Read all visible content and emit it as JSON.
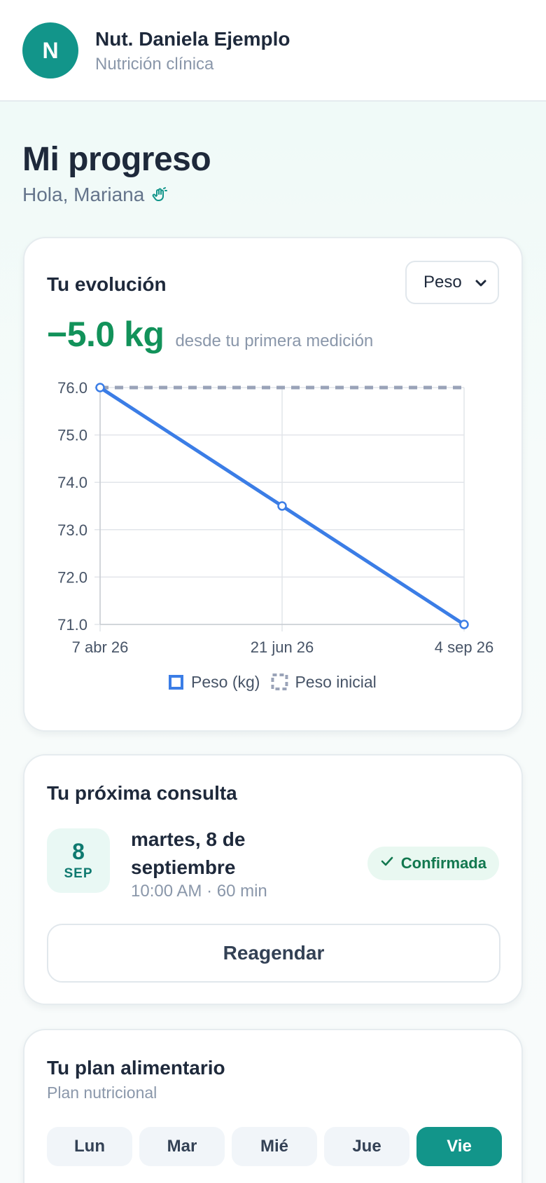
{
  "header": {
    "avatar_initial": "N",
    "nutritionist_name": "Nut. Daniela Ejemplo",
    "specialty": "Nutrición clínica"
  },
  "page": {
    "title": "Mi progreso",
    "greeting": "Hola, Mariana",
    "greeting_icon": "waving-hand-icon"
  },
  "evolution": {
    "title": "Tu evolución",
    "metric_select": {
      "selected": "Peso"
    },
    "delta_value": "−5.0 kg",
    "delta_caption": "desde tu primera medición"
  },
  "chart_data": {
    "type": "line",
    "x": [
      "7 abr 26",
      "21 jun 26",
      "4 sep 26"
    ],
    "series": [
      {
        "name": "Peso (kg)",
        "values": [
          76.0,
          73.5,
          71.0
        ],
        "color": "#3b7de6",
        "style": "solid"
      },
      {
        "name": "Peso inicial",
        "values": [
          76.0,
          76.0,
          76.0
        ],
        "color": "#9aa3b8",
        "style": "dashed"
      }
    ],
    "yticks": [
      "76.0",
      "75.0",
      "74.0",
      "73.0",
      "72.0",
      "71.0"
    ],
    "ylim": [
      71,
      76
    ],
    "grid": true,
    "legend_position": "bottom"
  },
  "next_appointment": {
    "title": "Tu próxima consulta",
    "day": "8",
    "month": "SEP",
    "date_text": "martes, 8 de septiembre",
    "time_text": "10:00 AM · 60 min",
    "status": "Confirmada",
    "reschedule_label": "Reagendar"
  },
  "meal_plan": {
    "title": "Tu plan alimentario",
    "subtitle": "Plan nutricional",
    "days": [
      "Lun",
      "Mar",
      "Mié",
      "Jue",
      "Vie"
    ],
    "active_day": "Vie"
  },
  "colors": {
    "brand": "#12958a",
    "success": "#12925a",
    "line": "#3b7de6"
  }
}
